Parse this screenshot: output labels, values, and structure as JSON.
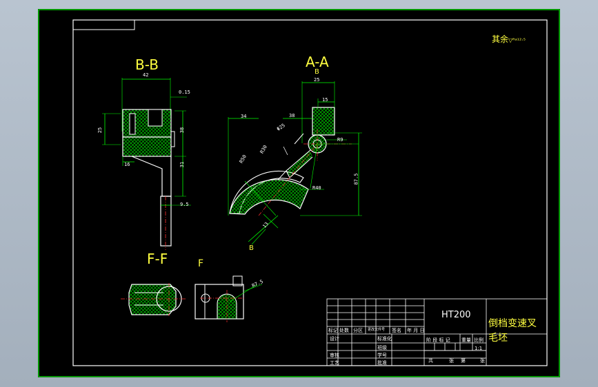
{
  "drawing": {
    "roughness_note": "其余",
    "roughness_symbol": "▽ᴿᵃ¹²·⁵",
    "view_bb": "B-B",
    "view_aa": "A-A",
    "view_ff": "F-F",
    "view_f_arrow": "F",
    "view_b_arrow": "B",
    "section_b_mark": "B"
  },
  "dimensions": {
    "d42": "42",
    "d0_15": "0.15",
    "d25_bb": "25",
    "d38": "38",
    "d31": "31",
    "d16": "16",
    "d9_5": "9.5",
    "d25_aa": "25",
    "d15": "15",
    "d34": "34",
    "d38_aa": "38",
    "dphi25": "Φ25",
    "dR9": "R9",
    "dR40": "R40",
    "d87_5": "87.5",
    "dR50": "R50",
    "dR30": "R30",
    "d13": "13",
    "dR7_5": "R7.5"
  },
  "title_block": {
    "material": "HT200",
    "part_name_line1": "倒档变速叉",
    "part_name_line2": "毛坯",
    "row_labels": [
      "标记",
      "处数",
      "分区",
      "更改文件号",
      "签名",
      "年 月 日"
    ],
    "design": "设计",
    "standardize": "标准化",
    "review": "审核",
    "process": "工艺",
    "class": "班级",
    "student_no": "学号",
    "approve": "批准",
    "stage_labels": [
      "阶 段 标 记",
      "重量",
      "比例"
    ],
    "scale": "1:1",
    "sheets": [
      "共",
      "张",
      "第",
      "张"
    ]
  },
  "colors": {
    "frame": "#00c800",
    "outline": "#ffffff",
    "dimension": "#00ff00",
    "hatch": "#00c800",
    "center": "#ff3030",
    "background": "#000000"
  }
}
